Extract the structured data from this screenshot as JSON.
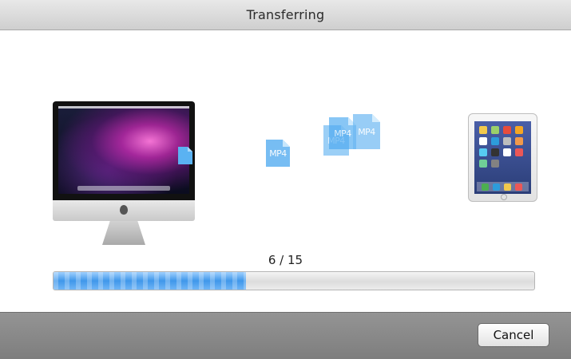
{
  "window": {
    "title": "Transferring"
  },
  "source_device": {
    "icon": "imac-icon",
    "file_badge_icon": "file-icon"
  },
  "destination_device": {
    "icon": "ipad-icon"
  },
  "transfer_files": [
    {
      "label": "MP4"
    },
    {
      "label": "MP4"
    },
    {
      "label": "MP4"
    },
    {
      "label": "MP4"
    }
  ],
  "progress": {
    "text": "6 / 15",
    "current": 6,
    "total": 15,
    "fraction": 0.4
  },
  "actions": {
    "cancel_label": "Cancel"
  },
  "colors": {
    "progress_fill": "#3f97ea",
    "file_icon": "#4aa8f0",
    "bottom_bar": "#8a8a8a"
  }
}
